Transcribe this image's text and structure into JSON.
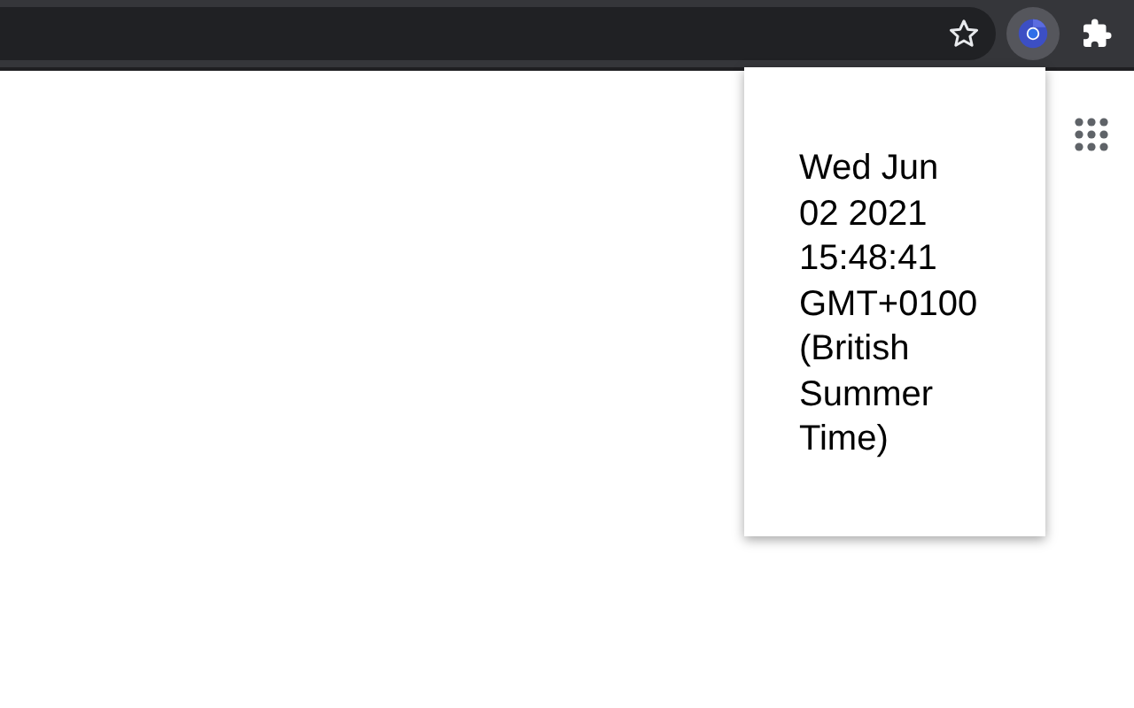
{
  "popup": {
    "text": "Wed Jun 02 2021 15:48:41 GMT+0100 (British Summer Time)"
  },
  "toolbar": {
    "extension_active": true
  }
}
